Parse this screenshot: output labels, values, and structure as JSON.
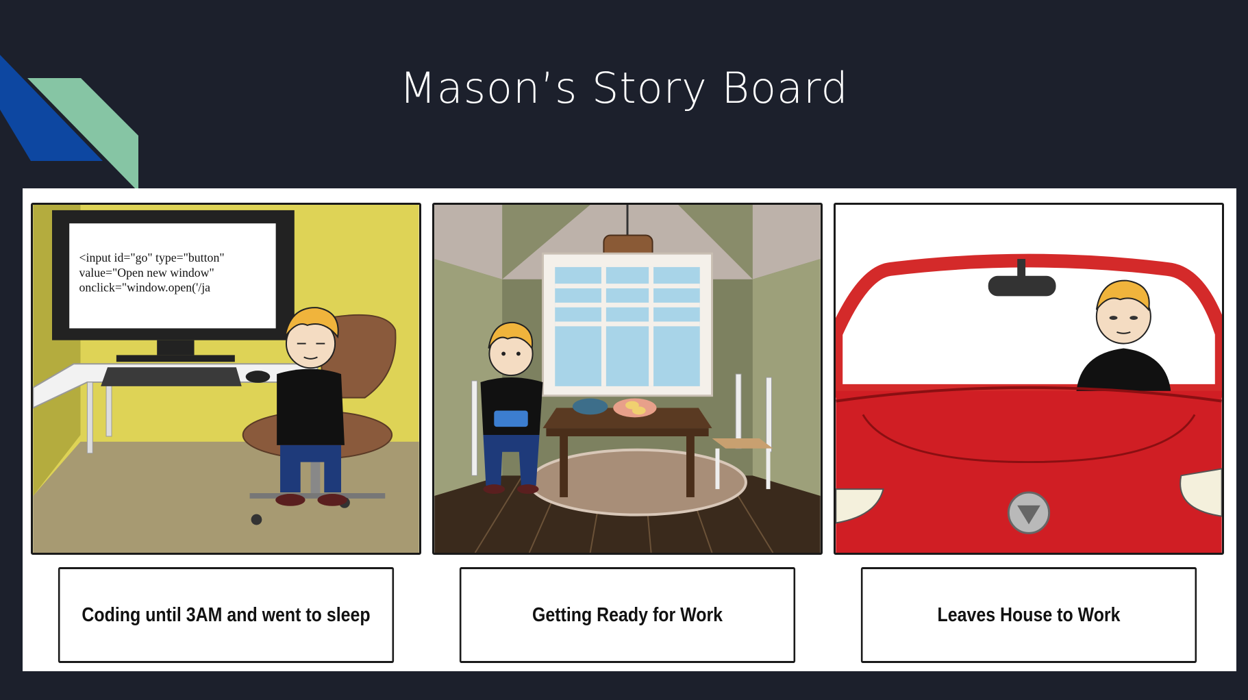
{
  "slide": {
    "title": "Mason’s Story Board",
    "accent_colors": {
      "background": "#1c202c",
      "stripe_blue": "#0d47a1",
      "stripe_green": "#86c5a4"
    }
  },
  "panels": [
    {
      "caption": "Coding until 3AM and went to sleep",
      "monitor_code": [
        "<input id=\"go\" type=\"button\"",
        "value=\"Open new window\"",
        "onclick=\"window.open('/ja"
      ]
    },
    {
      "caption": "Getting Ready for Work"
    },
    {
      "caption": "Leaves House to Work"
    }
  ]
}
